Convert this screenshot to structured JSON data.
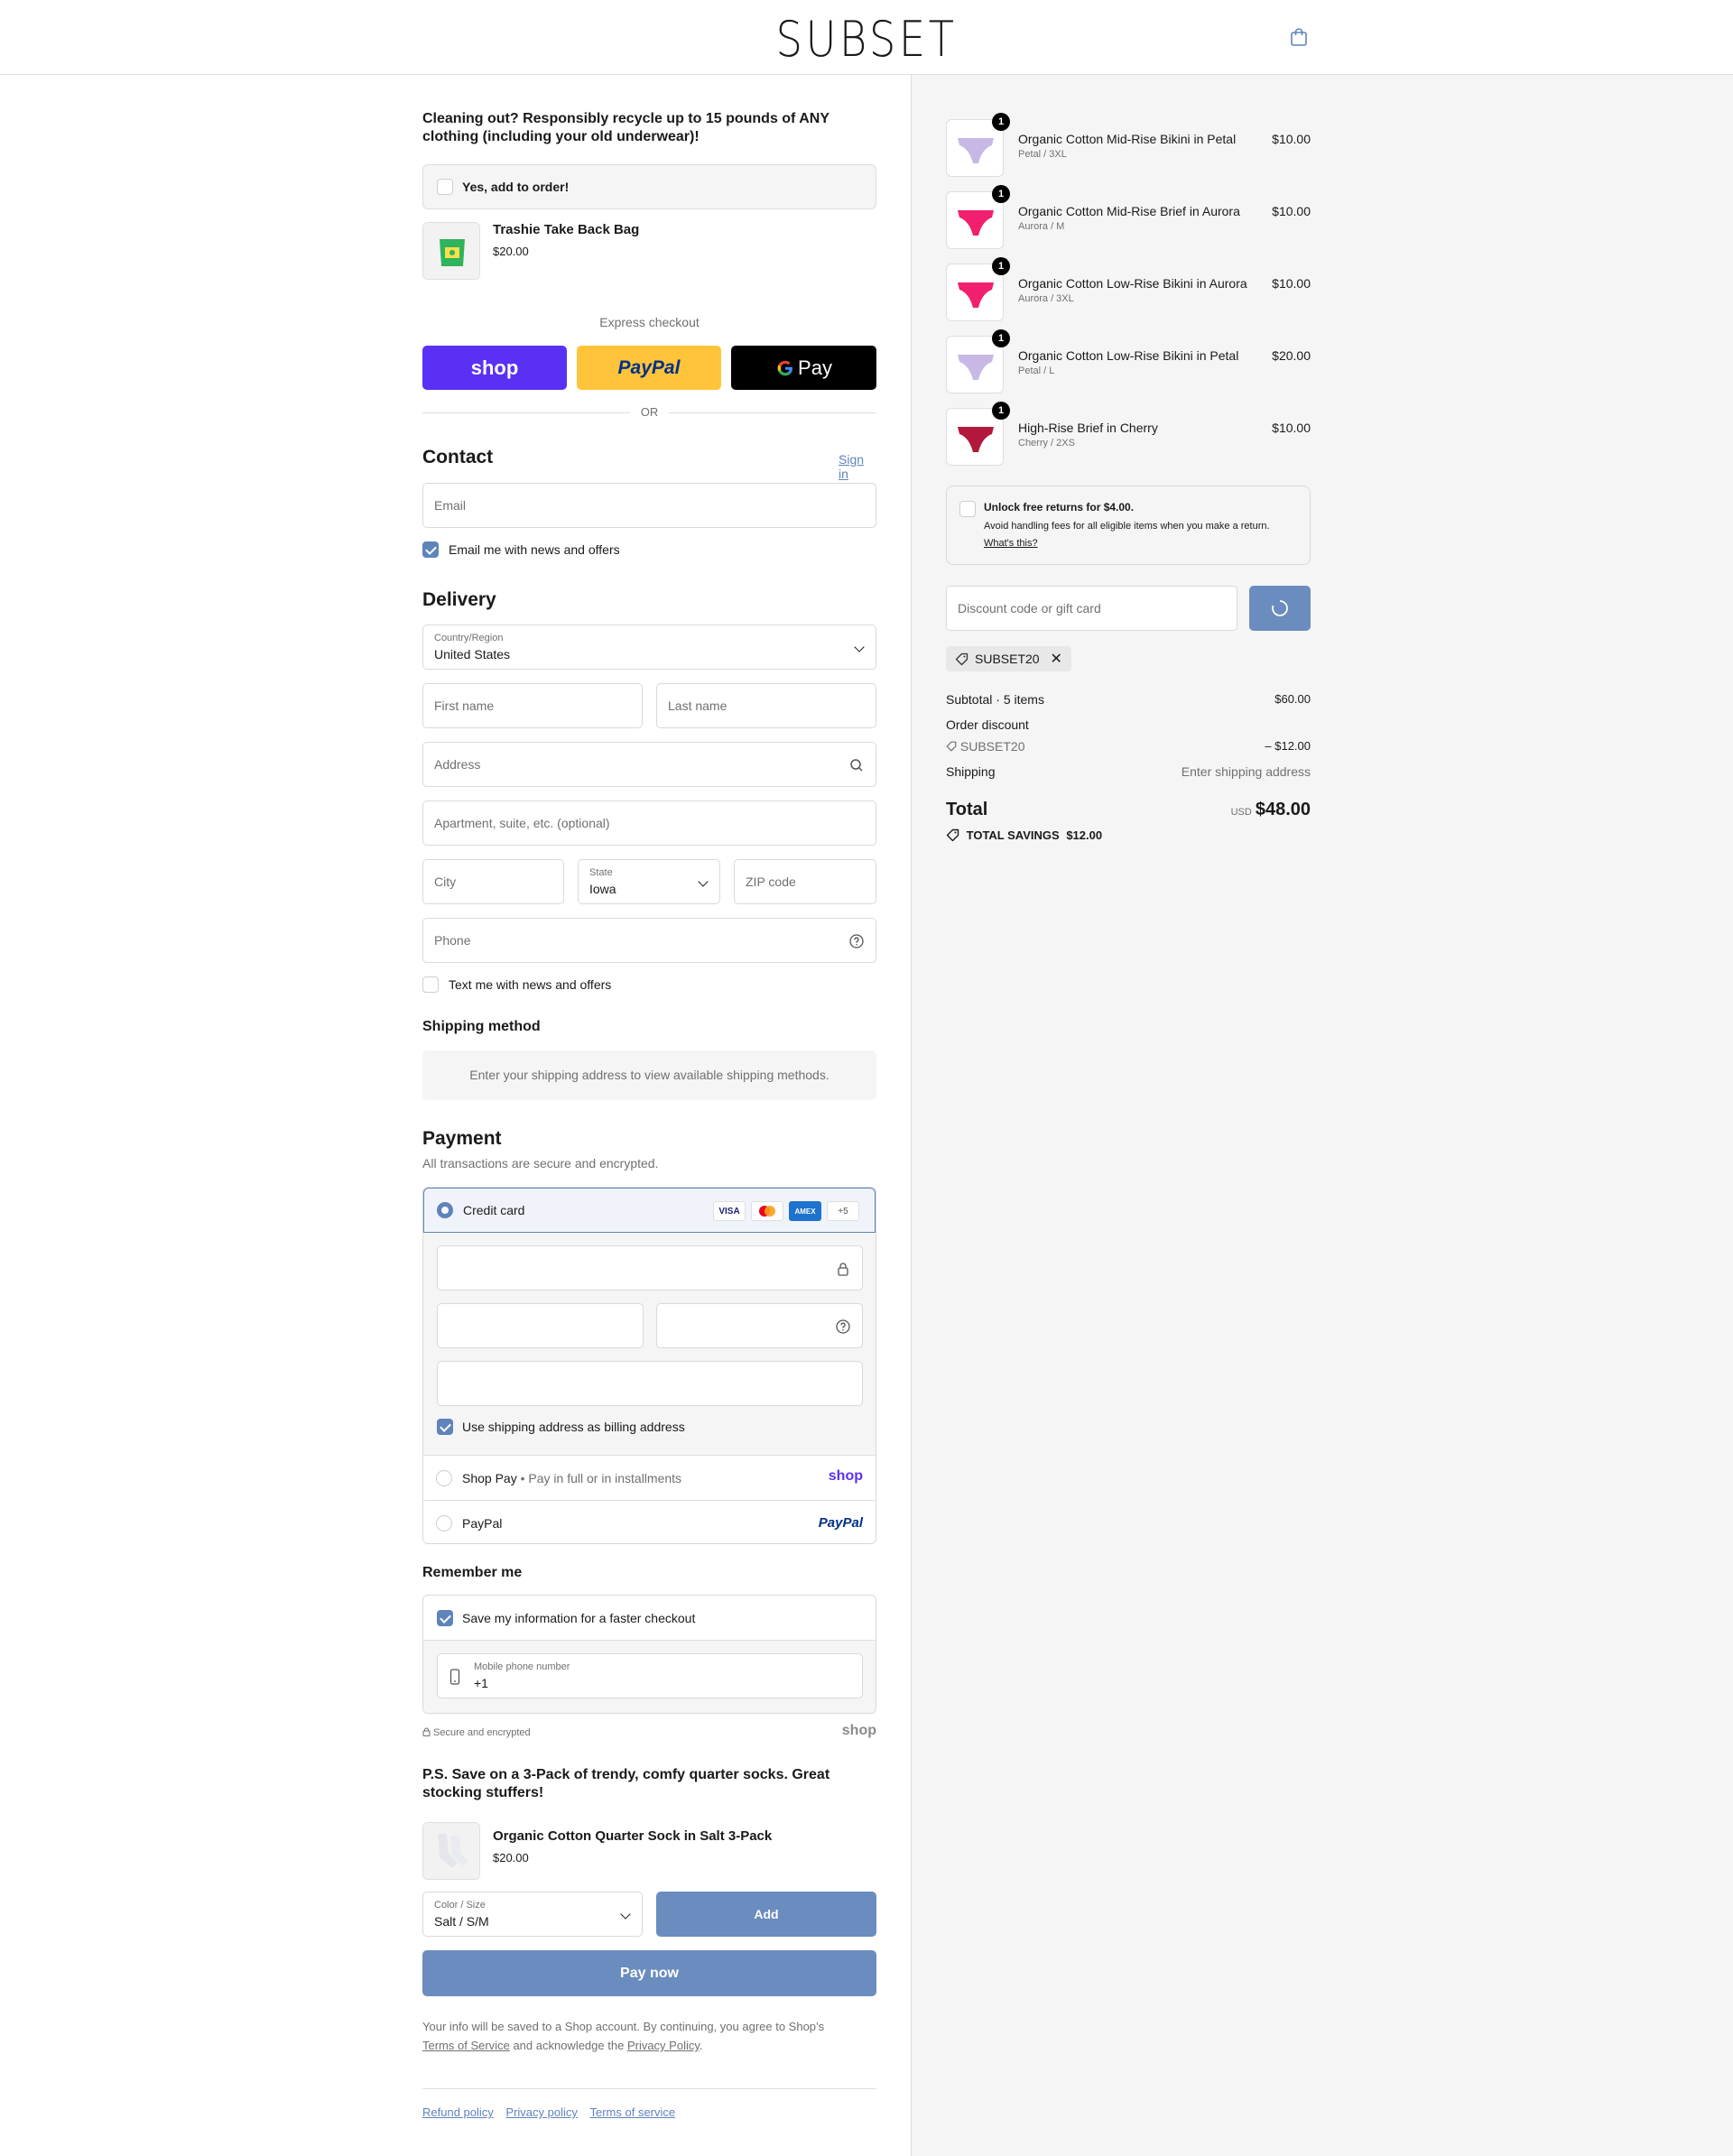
{
  "header": {
    "brand": "SUBSET",
    "cart_icon": "shopping-bag-icon"
  },
  "upsell": {
    "title": "Cleaning out? Responsibly recycle up to 15 pounds of ANY clothing (including your old underwear)!",
    "checkbox_label": "Yes, add to order!",
    "product_name": "Trashie Take Back Bag",
    "product_price": "$20.00"
  },
  "express": {
    "label": "Express checkout",
    "shop_label": "shop",
    "paypal_label": "PayPal",
    "gpay_label": "Pay",
    "or": "OR"
  },
  "contact": {
    "heading": "Contact",
    "sign_in": "Sign in",
    "email_placeholder": "Email",
    "news_label": "Email me with news and offers",
    "news_checked": true
  },
  "delivery": {
    "heading": "Delivery",
    "country_label": "Country/Region",
    "country_value": "United States",
    "first_name_placeholder": "First name",
    "last_name_placeholder": "Last name",
    "address_placeholder": "Address",
    "apartment_placeholder": "Apartment, suite, etc. (optional)",
    "city_placeholder": "City",
    "state_label": "State",
    "state_value": "Iowa",
    "zip_placeholder": "ZIP code",
    "phone_placeholder": "Phone",
    "text_label": "Text me with news and offers",
    "text_checked": false
  },
  "shipping": {
    "heading": "Shipping method",
    "message": "Enter your shipping address to view available shipping methods."
  },
  "payment": {
    "heading": "Payment",
    "subtitle": "All transactions are secure and encrypted.",
    "credit_card_label": "Credit card",
    "brands": [
      "VISA",
      "MC",
      "AMEX",
      "+5"
    ],
    "billing_label": "Use shipping address as billing address",
    "billing_checked": true,
    "shop_pay_label": "Shop Pay",
    "shop_pay_sub": "Pay in full or in installments",
    "shop_logo": "shop",
    "paypal_label": "PayPal",
    "paypal_logo": "PayPal"
  },
  "remember": {
    "heading": "Remember me",
    "save_label": "Save my information for a faster checkout",
    "save_checked": true,
    "phone_label": "Mobile phone number",
    "phone_value": "+1",
    "secure_label": "Secure and encrypted",
    "shop_logo": "shop"
  },
  "socks": {
    "title": "P.S. Save on a 3-Pack of trendy, comfy quarter socks. Great stocking stuffers!",
    "product_name": "Organic Cotton Quarter Sock in Salt 3-Pack",
    "product_price": "$20.00",
    "variant_label": "Color / Size",
    "variant_value": "Salt / S/M",
    "add_label": "Add"
  },
  "pay_now": "Pay now",
  "legal": {
    "text1": "Your info will be saved to a Shop account. By continuing, you agree to Shop’s",
    "terms": "Terms of Service",
    "text2": "and acknowledge the",
    "privacy": "Privacy Policy",
    "end": "."
  },
  "footer_links": [
    "Refund policy",
    "Privacy policy",
    "Terms of service"
  ],
  "cart": {
    "items": [
      {
        "name": "Organic Cotton Mid-Rise Bikini in Petal",
        "variant": "Petal / 3XL",
        "price": "$10.00",
        "qty": "1",
        "color": "#c8b8e6"
      },
      {
        "name": "Organic Cotton Mid-Rise Brief in Aurora",
        "variant": "Aurora / M",
        "price": "$10.00",
        "qty": "1",
        "color": "#f21e6e"
      },
      {
        "name": "Organic Cotton Low-Rise Bikini in Aurora",
        "variant": "Aurora / 3XL",
        "price": "$10.00",
        "qty": "1",
        "color": "#f21e6e"
      },
      {
        "name": "Organic Cotton Low-Rise Bikini in Petal",
        "variant": "Petal / L",
        "price": "$20.00",
        "qty": "1",
        "color": "#c8b8e6"
      },
      {
        "name": "High-Rise Brief in Cherry",
        "variant": "Cherry / 2XS",
        "price": "$10.00",
        "qty": "1",
        "color": "#b3173a"
      }
    ],
    "returns_title": "Unlock free returns for $4.00.",
    "returns_text": "Avoid handling fees for all eligible items when you make a return.",
    "returns_link": "What's this?",
    "discount_placeholder": "Discount code or gift card",
    "discount_tag": "SUBSET20",
    "subtotal_label": "Subtotal · 5 items",
    "subtotal_value": "$60.00",
    "order_discount_label": "Order discount",
    "discount_code": "SUBSET20",
    "discount_value": "– $12.00",
    "shipping_label": "Shipping",
    "shipping_value": "Enter shipping address",
    "total_label": "Total",
    "currency": "USD",
    "total_value": "$48.00",
    "savings_label": "TOTAL SAVINGS",
    "savings_value": "$12.00"
  },
  "colors": {
    "accent": "#5f83bb",
    "button": "#6b8cbe",
    "shop_purple": "#5a31f4",
    "paypal_yellow": "#ffc439"
  }
}
